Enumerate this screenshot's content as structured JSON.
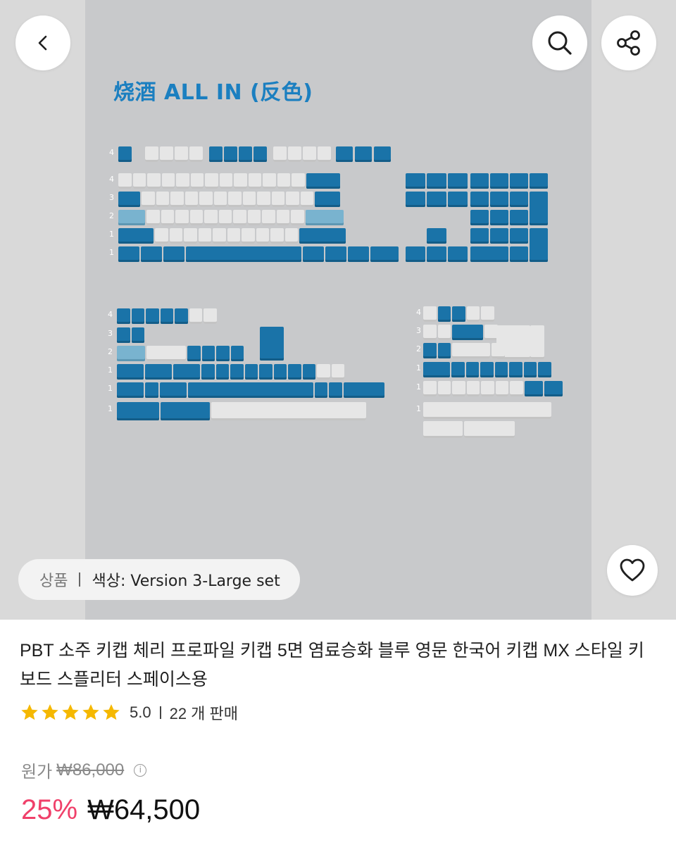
{
  "header": {
    "back_icon": "chevron-left-icon",
    "search_icon": "search-icon",
    "share_icon": "share-icon"
  },
  "hero": {
    "image_title": "烧酒 ALL IN (反色)",
    "variant_label": "상품",
    "variant_value": "색상: Version 3-Large set",
    "wishlist_icon": "heart-icon",
    "colors": {
      "blue_key": "#1a73a8",
      "white_key": "#e6e6e6",
      "light_key": "#79b3cf",
      "background": "#c8c9cb"
    }
  },
  "product": {
    "title": "PBT 소주 키캡 체리 프로파일 키캡 5면 염료승화 블루 영문 한국어 키캡 MX 스타일 키보드 스플리터 스페이스용",
    "rating": "5.0",
    "rating_stars": 5,
    "sales": "22 개 판매",
    "original_price_label": "원가",
    "original_price": "₩86,000",
    "discount": "25%",
    "price": "₩64,500",
    "colors": {
      "discount": "#f0406a",
      "star": "#f5b800"
    }
  }
}
